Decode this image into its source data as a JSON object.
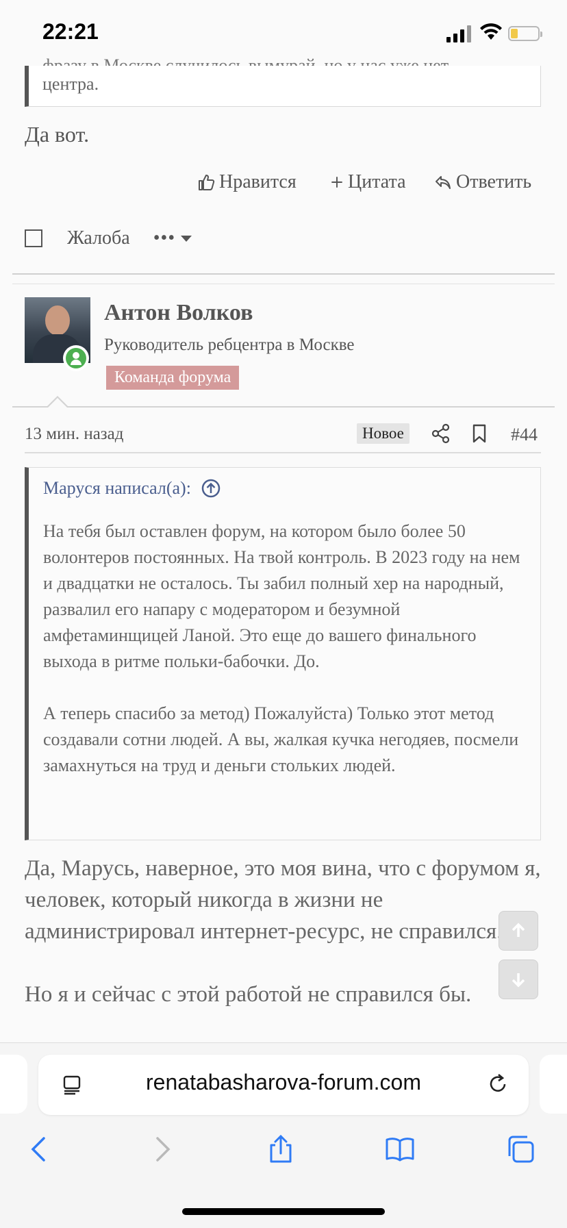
{
  "status": {
    "time": "22:21"
  },
  "prev_post": {
    "quote_cut": "фразу в Москве случилось вымурай, но у нас уже нет",
    "quote_end": "центра.",
    "message": "Да вот.",
    "like_label": "Нравится",
    "quote_label": "Цитата",
    "reply_label": "Ответить",
    "report_label": "Жалоба",
    "more_label": "•••"
  },
  "post": {
    "author": "Антон Волков",
    "role": "Руководитель ребцентра в Москве",
    "badge": "Команда форума",
    "time": "13 мин. назад",
    "new_label": "Новое",
    "number": "#44",
    "quote_author": "Маруся написал(а):",
    "quote_text": "На тебя был оставлен форум, на котором было более 50 волонтеров постоянных. На твой контроль. В 2023 году на нем и двадцатки не осталось. Ты забил полный хер на народный, развалил его напару с модератором и безумной амфетаминщицей Ланой. Это еще до вашего финального выхода в ритме польки-бабочки. До.\n\nА теперь спасибо за метод) Пожалуйста) Только этот метод создавали сотни людей. А вы, жалкая кучка негодяев, посмели замахнуться на труд и деньги стольких людей.",
    "body": "Да, Марусь, наверное, это моя вина, что с форумом я, человек, который никогда в жизни не администрировал интернет-ресурс, не справился.\n\nНо я и сейчас с этой работой не справился бы."
  },
  "browser": {
    "url": "renatabasharova-forum.com"
  },
  "colors": {
    "badge": "#d49a9a",
    "quote_link": "#4a5e8e",
    "online": "#4caf50",
    "safari_blue": "#2f7bf5"
  }
}
